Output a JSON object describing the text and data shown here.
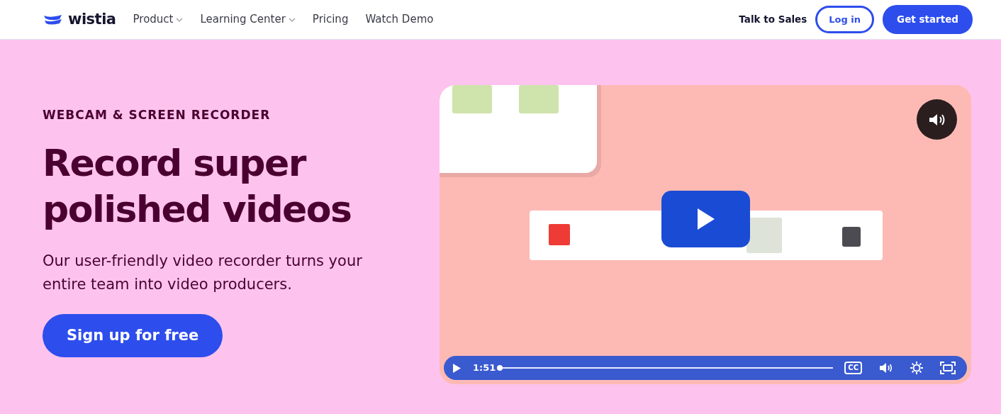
{
  "navbar": {
    "logo": "wistia",
    "menu": [
      {
        "label": "Product",
        "dropdown": true
      },
      {
        "label": "Learning Center",
        "dropdown": true
      },
      {
        "label": "Pricing",
        "dropdown": false
      },
      {
        "label": "Watch Demo",
        "dropdown": false
      }
    ],
    "talk": "Talk to Sales",
    "login": "Log in",
    "cta": "Get started"
  },
  "hero": {
    "eyebrow": "WEBCAM & SCREEN RECORDER",
    "title": "Record super polished videos",
    "subtitle": "Our user-friendly video recorder turns your entire team into video producers.",
    "button": "Sign up for free"
  },
  "video": {
    "kind": "picture",
    "muted": false,
    "time": "1:51",
    "level": 0.0,
    "captions": "CC"
  }
}
